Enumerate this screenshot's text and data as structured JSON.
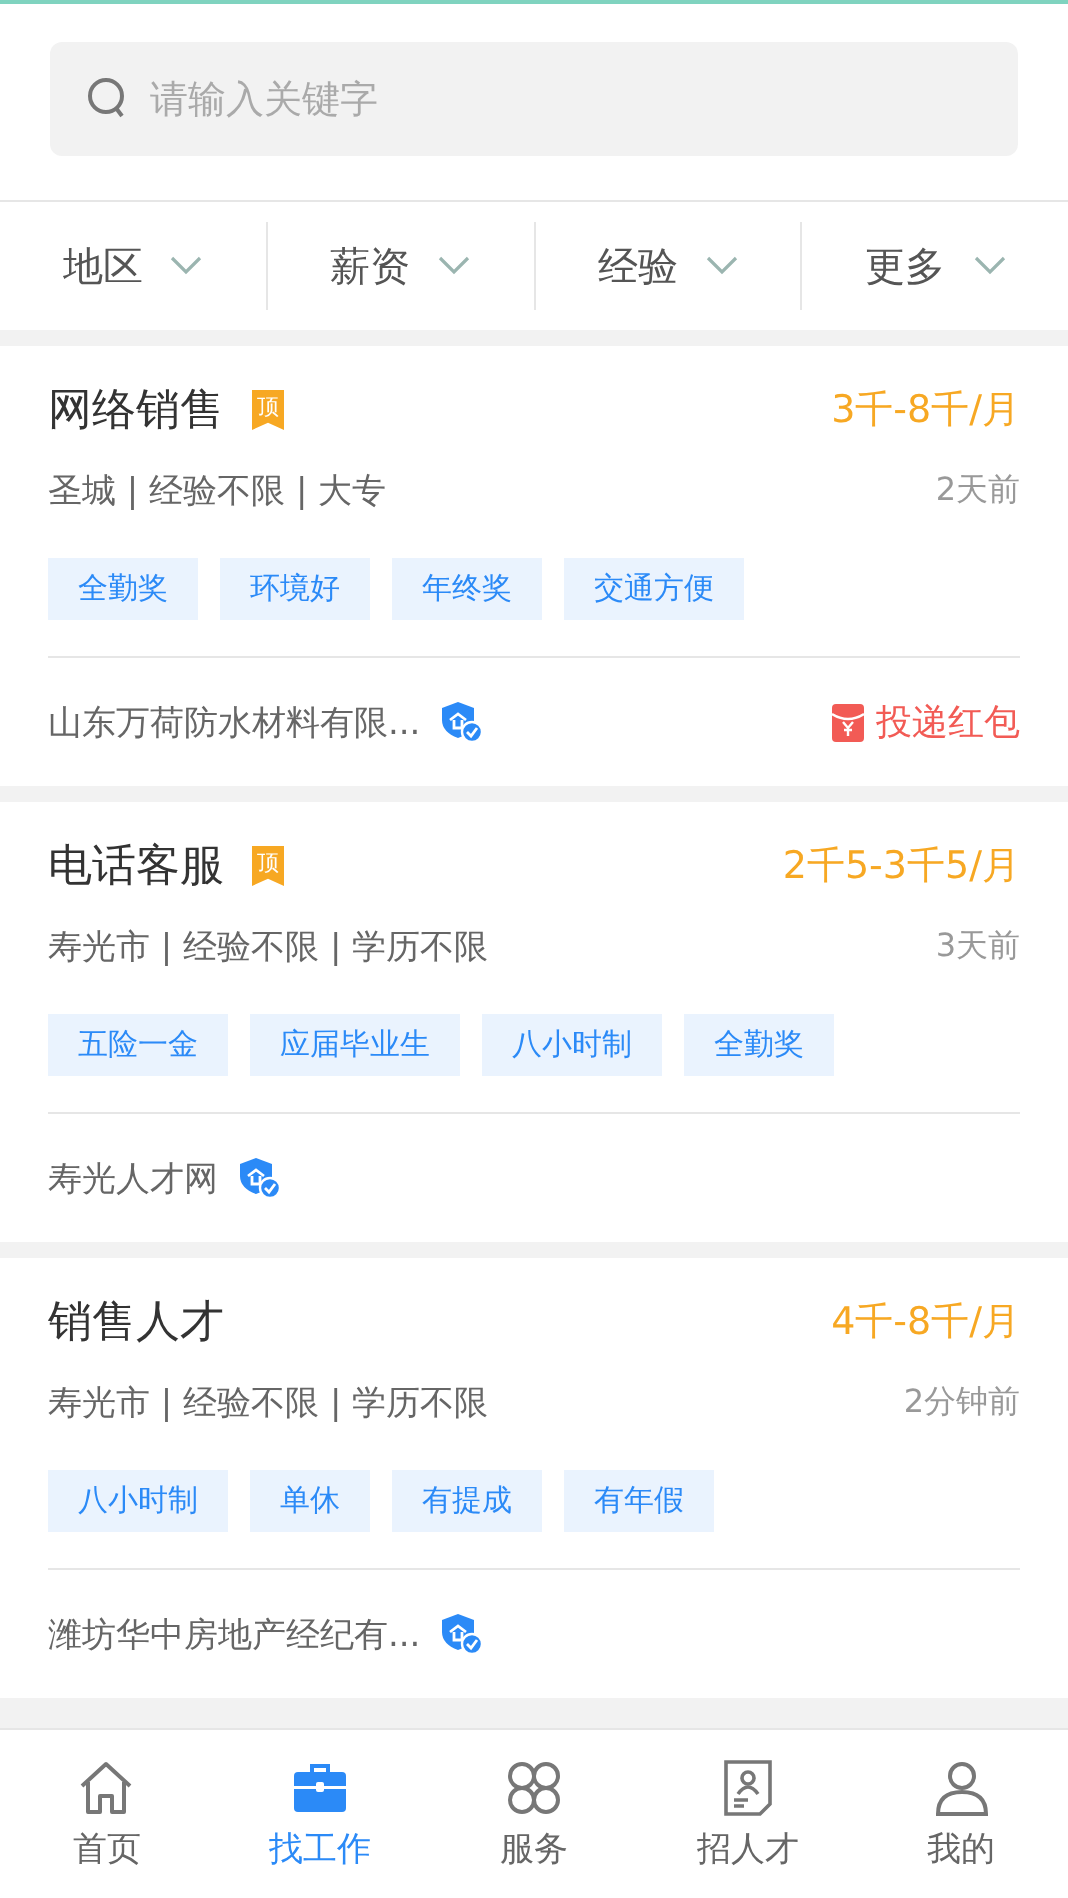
{
  "search": {
    "placeholder": "请输入关键字"
  },
  "filters": [
    {
      "label": "地区"
    },
    {
      "label": "薪资"
    },
    {
      "label": "经验"
    },
    {
      "label": "更多"
    }
  ],
  "jobs": [
    {
      "title": "网络销售",
      "badge": "顶",
      "salary": "3千-8千/月",
      "meta": "圣城 | 经验不限 | 大专",
      "time": "2天前",
      "tags": [
        "全勤奖",
        "环境好",
        "年终奖",
        "交通方便"
      ],
      "company": "山东万荷防水材料有限...",
      "verified": true,
      "action": "投递红包"
    },
    {
      "title": "电话客服",
      "badge": "顶",
      "salary": "2千5-3千5/月",
      "meta": "寿光市 | 经验不限 | 学历不限",
      "time": "3天前",
      "tags": [
        "五险一金",
        "应届毕业生",
        "八小时制",
        "全勤奖"
      ],
      "company": "寿光人才网",
      "verified": true
    },
    {
      "title": "销售人才",
      "salary": "4千-8千/月",
      "meta": "寿光市 | 经验不限 | 学历不限",
      "time": "2分钟前",
      "tags": [
        "八小时制",
        "单休",
        "有提成",
        "有年假"
      ],
      "company": "潍坊华中房地产经纪有...",
      "verified": true
    }
  ],
  "nav": [
    {
      "kind": "home",
      "label": "首页",
      "selected": false
    },
    {
      "kind": "jobs",
      "label": "找工作",
      "selected": true
    },
    {
      "kind": "services",
      "label": "服务",
      "selected": false
    },
    {
      "kind": "recruit",
      "label": "招人才",
      "selected": false
    },
    {
      "kind": "me",
      "label": "我的",
      "selected": false
    }
  ]
}
